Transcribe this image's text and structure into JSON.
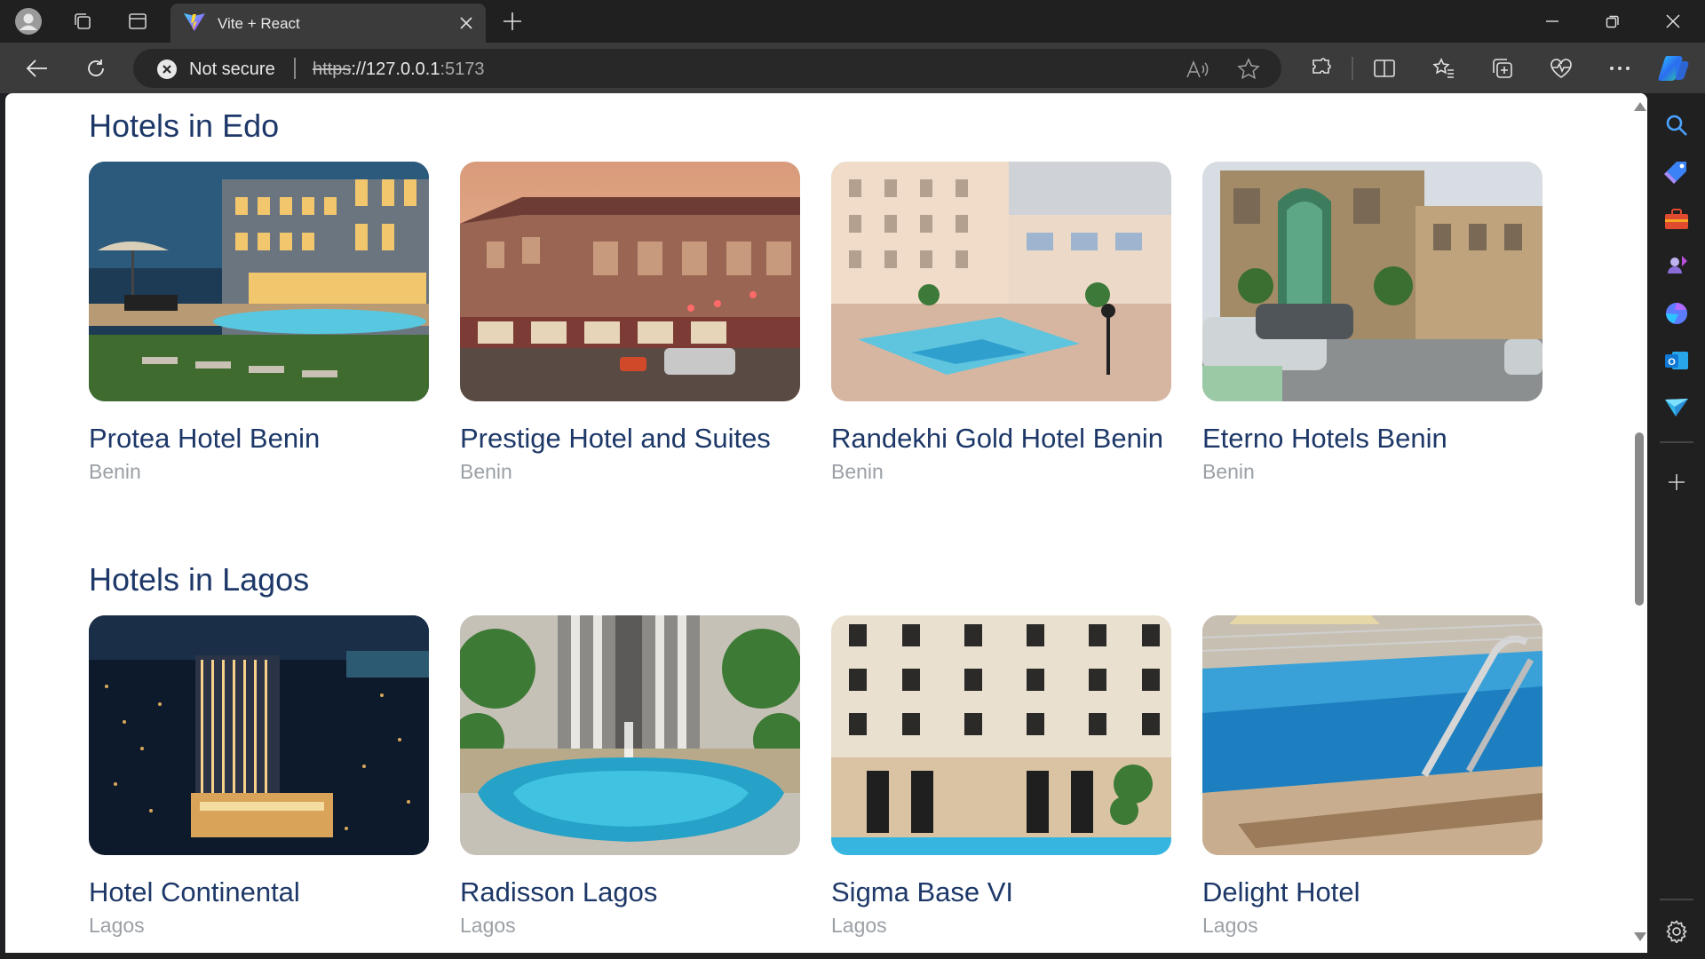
{
  "browser": {
    "tab_title": "Vite + React",
    "security_label": "Not secure",
    "url_scheme": "https",
    "url_host": "://127.0.0.1",
    "url_port": ":5173",
    "icons": {
      "profile": "profile-avatar-icon",
      "workspaces": "workspaces-icon",
      "tab_actions": "vertical-tabs-icon",
      "tab_close": "close-icon",
      "new_tab": "plus-icon",
      "minimize": "minimize-icon",
      "restore": "restore-icon",
      "close_window": "close-icon",
      "back": "back-arrow-icon",
      "refresh": "refresh-icon",
      "read_aloud": "read-aloud-icon",
      "favorite": "star-icon",
      "extensions": "puzzle-icon",
      "split_screen": "split-screen-icon",
      "favorites": "favorites-icon",
      "collections": "collections-icon",
      "performance": "heart-pulse-icon",
      "more": "ellipsis-icon",
      "copilot": "copilot-icon"
    }
  },
  "sidebar": {
    "items": [
      {
        "icon": "search-icon",
        "color": "#4aa3ff"
      },
      {
        "icon": "shopping-tag-icon",
        "color": "#3b82f6"
      },
      {
        "icon": "toolbox-icon",
        "color": "#e04a2f"
      },
      {
        "icon": "games-icon",
        "color": "#8a6bd8"
      },
      {
        "icon": "microsoft365-icon",
        "color": "#5b7cff"
      },
      {
        "icon": "outlook-icon",
        "color": "#0f78d4"
      },
      {
        "icon": "send-icon",
        "color": "#35b5e8"
      }
    ],
    "add_icon": "plus-icon",
    "settings_icon": "gear-icon"
  },
  "page": {
    "sections": [
      {
        "title": "Hotels in Edo",
        "hotels": [
          {
            "name": "Protea Hotel Benin",
            "city": "Benin"
          },
          {
            "name": "Prestige Hotel and Suites",
            "city": "Benin"
          },
          {
            "name": "Randekhi Gold Hotel Benin",
            "city": "Benin"
          },
          {
            "name": "Eterno Hotels Benin",
            "city": "Benin"
          }
        ]
      },
      {
        "title": "Hotels in Lagos",
        "hotels": [
          {
            "name": "Hotel Continental",
            "city": "Lagos"
          },
          {
            "name": "Radisson Lagos",
            "city": "Lagos"
          },
          {
            "name": "Sigma Base VI",
            "city": "Lagos"
          },
          {
            "name": "Delight Hotel",
            "city": "Lagos"
          }
        ]
      }
    ]
  },
  "colors": {
    "heading": "#1d3868",
    "muted": "#9aa0a6",
    "chrome_dark": "#202020",
    "chrome_mid": "#3b3b3b"
  }
}
